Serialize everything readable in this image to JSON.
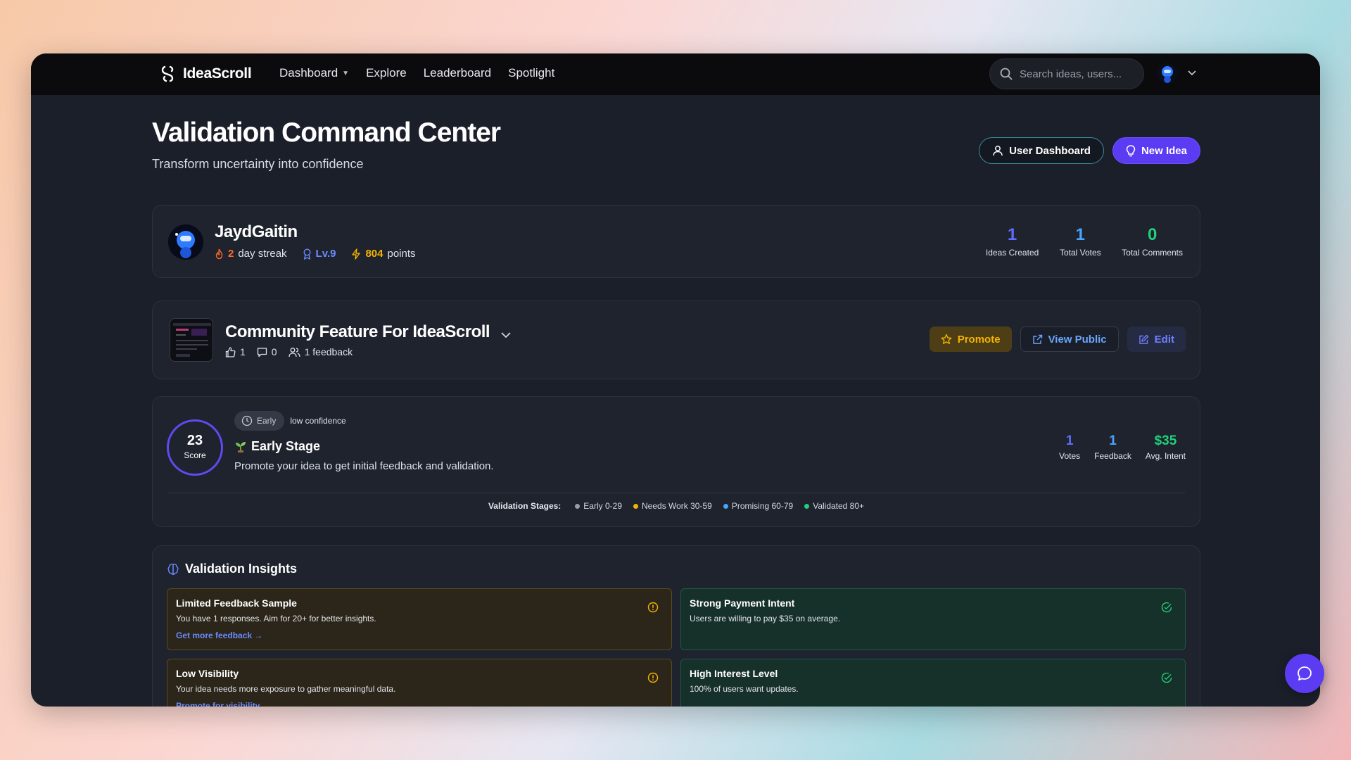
{
  "brand": {
    "name": "IdeaScroll"
  },
  "nav": {
    "links": [
      {
        "label": "Dashboard",
        "has_dropdown": true
      },
      {
        "label": "Explore"
      },
      {
        "label": "Leaderboard"
      },
      {
        "label": "Spotlight"
      }
    ],
    "search_placeholder": "Search ideas, users..."
  },
  "page": {
    "title": "Validation Command Center",
    "subtitle": "Transform uncertainty into confidence",
    "user_dashboard_label": "User Dashboard",
    "new_idea_label": "New Idea"
  },
  "profile": {
    "name": "JaydGaitin",
    "streak_value": "2",
    "streak_label": "day streak",
    "level": "Lv.9",
    "points_value": "804",
    "points_label": "points",
    "stats": [
      {
        "value": "1",
        "label": "Ideas Created",
        "color": "#5f6cff"
      },
      {
        "value": "1",
        "label": "Total Votes",
        "color": "#4aa3ff"
      },
      {
        "value": "0",
        "label": "Total Comments",
        "color": "#21d07a"
      }
    ]
  },
  "idea": {
    "title": "Community Feature For IdeaScroll",
    "likes": "1",
    "comments": "0",
    "feedback": "1 feedback",
    "promote_label": "Promote",
    "view_public_label": "View Public",
    "edit_label": "Edit"
  },
  "score": {
    "value": "23",
    "label": "Score",
    "tag": "Early",
    "confidence": "low confidence",
    "stage_name": "Early Stage",
    "stage_desc": "Promote your idea to get initial feedback and validation.",
    "stats": [
      {
        "value": "1",
        "label": "Votes",
        "color": "#5f6cff"
      },
      {
        "value": "1",
        "label": "Feedback",
        "color": "#4aa3ff"
      },
      {
        "value": "$35",
        "label": "Avg. Intent",
        "color": "#21d07a"
      }
    ],
    "legend_title": "Validation Stages:",
    "legend": [
      {
        "label": "Early 0-29",
        "color": "#9a9ca6"
      },
      {
        "label": "Needs Work 30-59",
        "color": "#f5b400"
      },
      {
        "label": "Promising 60-79",
        "color": "#4aa3ff"
      },
      {
        "label": "Validated 80+",
        "color": "#21d07a"
      }
    ]
  },
  "insights": {
    "title": "Validation Insights",
    "items": [
      {
        "title": "Limited Feedback Sample",
        "text": "You have 1 responses. Aim for 20+ for better insights.",
        "link": "Get more feedback →",
        "kind": "warn"
      },
      {
        "title": "Strong Payment Intent",
        "text": "Users are willing to pay $35 on average.",
        "link": "",
        "kind": "ok"
      },
      {
        "title": "Low Visibility",
        "text": "Your idea needs more exposure to gather meaningful data.",
        "link": "Promote for visibility →",
        "kind": "warn"
      },
      {
        "title": "High Interest Level",
        "text": "100% of users want updates.",
        "link": "",
        "kind": "ok"
      }
    ]
  }
}
